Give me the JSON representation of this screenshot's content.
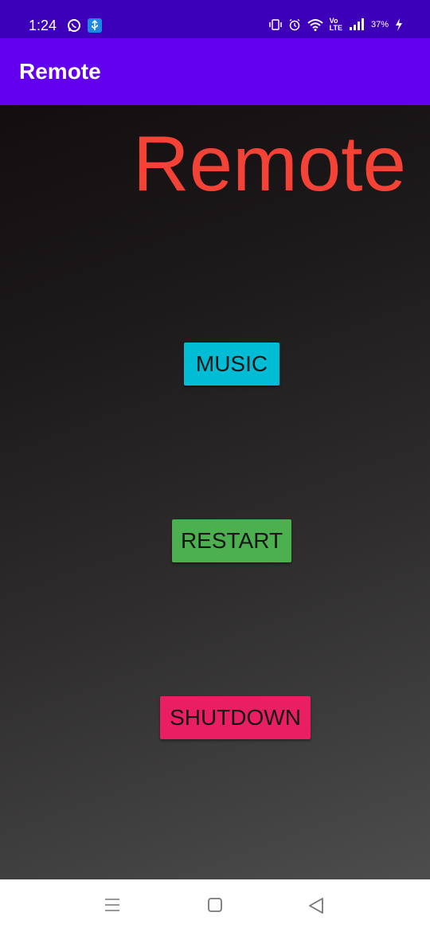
{
  "status_bar": {
    "time": "1:24",
    "battery": "37%",
    "icons": [
      "whatsapp-icon",
      "usb-icon",
      "vibrate-icon",
      "alarm-icon",
      "wifi-icon",
      "volte-icon",
      "signal-icon",
      "charging-icon"
    ],
    "volte_top": "Vo",
    "volte_bottom": "LTE"
  },
  "app_bar": {
    "title": "Remote"
  },
  "main": {
    "heading": "Remote",
    "buttons": {
      "music": "MUSIC",
      "restart": "RESTART",
      "shutdown": "SHUTDOWN"
    }
  },
  "nav_bar": {
    "icons": [
      "menu-icon",
      "home-icon",
      "back-icon"
    ]
  },
  "colors": {
    "status_bar": "#3d00b8",
    "app_bar": "#6200ee",
    "heading": "#f44336",
    "music": "#00bcd4",
    "restart": "#4caf50",
    "shutdown": "#e91e63"
  }
}
